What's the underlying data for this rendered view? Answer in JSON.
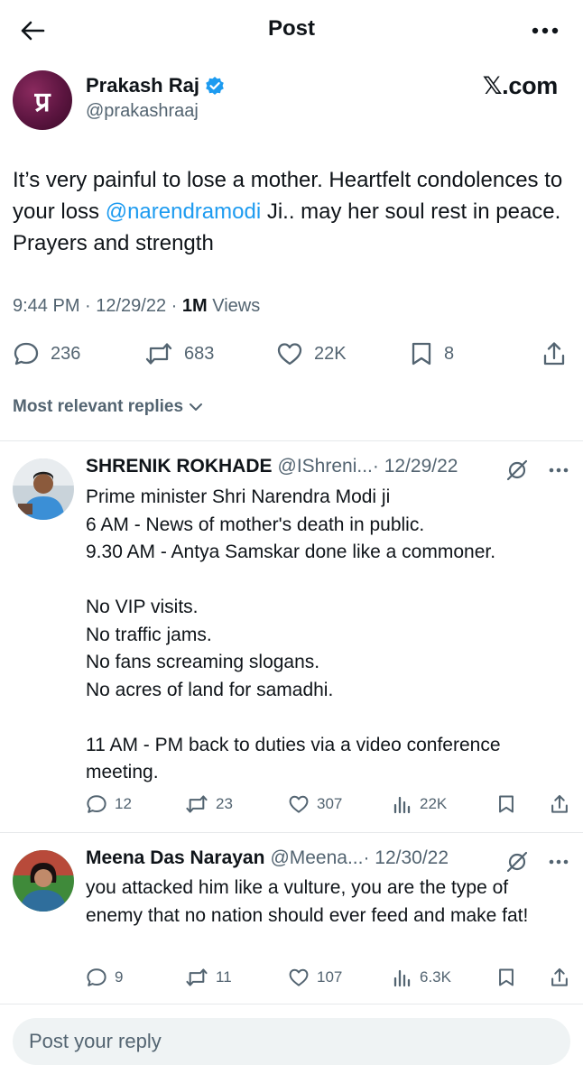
{
  "header": {
    "title": "Post"
  },
  "post": {
    "author_name": "Prakash Raj",
    "author_handle": "@prakashraaj",
    "avatar_text": "प्र",
    "source_label": "𝕏.com",
    "text_before": "It’s very painful to lose a mother. Heartfelt condolences to your loss ",
    "mention": "@narendramodi",
    "text_after": " Ji.. may her soul rest in peace. Prayers and strength",
    "time": "9:44 PM · 12/29/22 · ",
    "views_count": "1M",
    "views_label": " Views",
    "stats": {
      "replies": "236",
      "reposts": "683",
      "likes": "22K",
      "bookmarks": "8"
    }
  },
  "replies_filter": "Most relevant replies",
  "replies": [
    {
      "name": "SHRENIK ROKHADE",
      "handle": "@IShreni...",
      "date": " · 12/29/22",
      "body": "Prime minister Shri Narendra Modi ji\n6 AM - News of mother's death in public.\n9.30 AM - Antya Samskar done like a commoner.\n\nNo VIP visits.\nNo traffic jams.\nNo fans screaming slogans.\nNo acres of land for samadhi.\n\n11 AM - PM back to duties via a video conference meeting.",
      "stats": {
        "replies": "12",
        "reposts": "23",
        "likes": "307",
        "views": "22K"
      }
    },
    {
      "name": "Meena Das Narayan",
      "handle": "@Meena...",
      "date": " · 12/30/22",
      "body": "you attacked him like a vulture, you are the type of enemy that no nation should ever feed and make fat!",
      "stats": {
        "replies": "9",
        "reposts": "11",
        "likes": "107",
        "views": "6.3K"
      }
    }
  ],
  "reply_bar": {
    "placeholder": "Post your reply"
  },
  "colors": {
    "accent": "#1d9bf0",
    "text": "#0f1419",
    "muted": "#536471"
  }
}
